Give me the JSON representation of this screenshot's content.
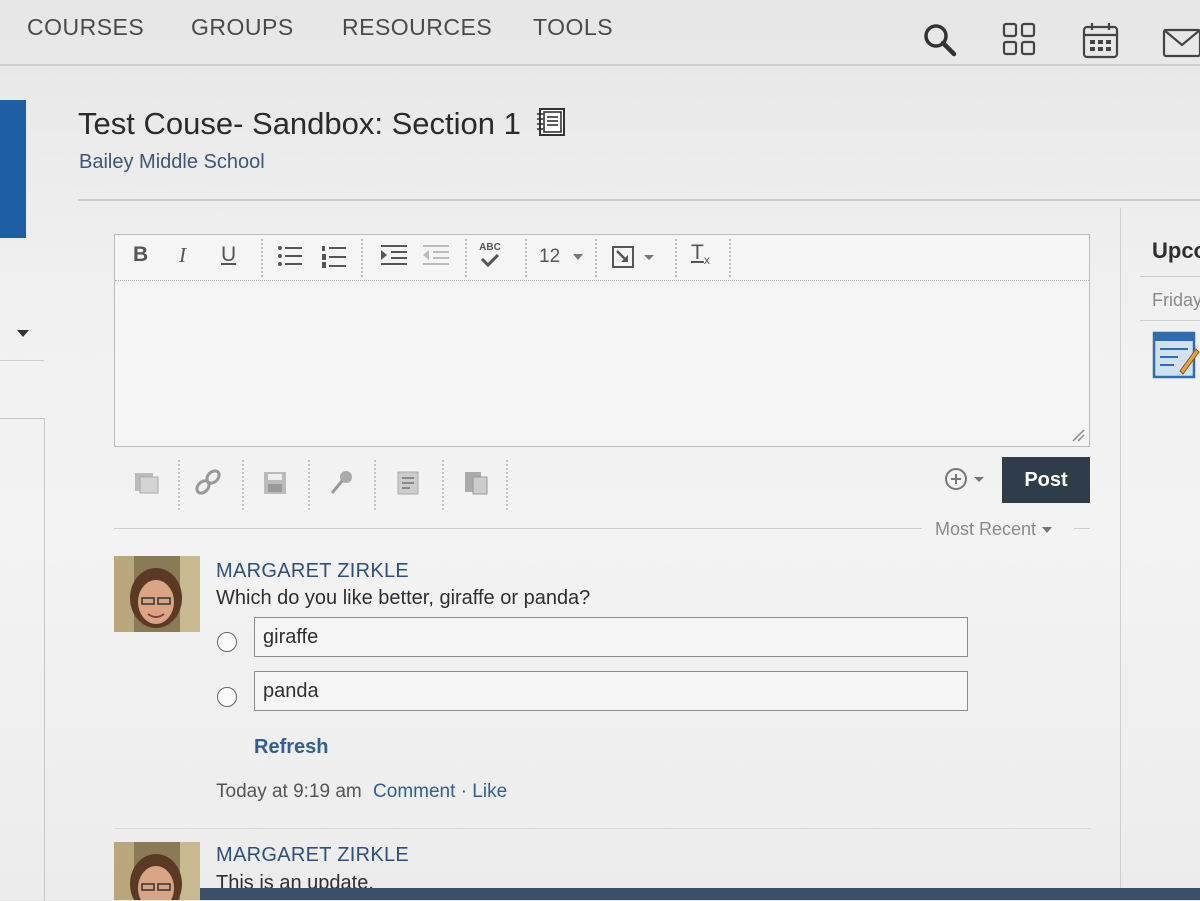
{
  "nav": {
    "items": [
      "COURSES",
      "GROUPS",
      "RESOURCES",
      "TOOLS"
    ],
    "icons": [
      "search-icon",
      "apps-grid-icon",
      "calendar-icon",
      "mail-icon"
    ]
  },
  "course": {
    "title": "Test Couse- Sandbox: Section 1",
    "school": "Bailey Middle School"
  },
  "editor": {
    "bold": "B",
    "italic": "I",
    "underline": "U",
    "spellcheck": "ABC",
    "font_size": "12",
    "clear_format": "T"
  },
  "post_button": "Post",
  "sort": "Most Recent",
  "right_panel": {
    "heading": "Upco",
    "day": "Friday"
  },
  "posts": [
    {
      "author": "MARGARET ZIRKLE",
      "message": "Which do you like better, giraffe or panda?",
      "options": [
        "giraffe",
        "panda"
      ],
      "refresh": "Refresh",
      "time": "Today at 9:19 am",
      "comment": "Comment",
      "separator": "·",
      "like": "Like"
    },
    {
      "author": "MARGARET ZIRKLE",
      "message": "This is an update."
    }
  ],
  "colors": {
    "post_button": "#2f3d4b",
    "link": "#2e5f95",
    "author": "#2e4f7c",
    "left_bar": "#1d5fa2"
  }
}
